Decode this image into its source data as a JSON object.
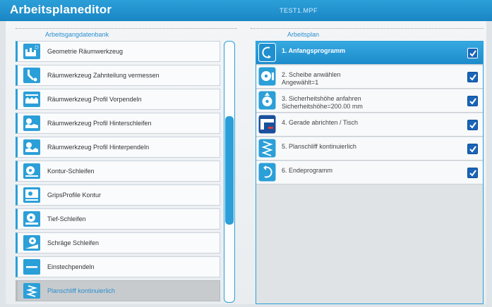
{
  "window": {
    "title": "Arbeitsplaneditor",
    "file_name": "TEST1.MPF"
  },
  "operations_db": {
    "heading": "Arbeitsgangdatenbank",
    "items": [
      {
        "label": "Geometrie Räumwerkzeug",
        "icon": "broach-geometry-icon"
      },
      {
        "label": "Räumwerkzeug Zahnteilung vermessen",
        "icon": "measure-probe-icon"
      },
      {
        "label": "Räumwerkzeug Profil Vorpendeln",
        "icon": "broach-profile-icon"
      },
      {
        "label": "Räumwerkzeug Profil Hinterschleifen",
        "icon": "broach-relief-icon"
      },
      {
        "label": "Räumwerkzeug Profil Hinterpendeln",
        "icon": "broach-backswing-icon"
      },
      {
        "label": "Kontur-Schleifen",
        "icon": "contour-grinding-icon"
      },
      {
        "label": "GripsProfile Kontur",
        "icon": "gripsprofile-icon"
      },
      {
        "label": "Tief-Schleifen",
        "icon": "deep-grinding-icon"
      },
      {
        "label": "Schräge Schleifen",
        "icon": "angled-grinding-icon"
      },
      {
        "label": "Einstechpendeln",
        "icon": "plunge-oscillation-icon"
      },
      {
        "label": "Planschliff kontinuierlich",
        "icon": "surface-grinding-icon",
        "selected": true
      }
    ]
  },
  "work_plan": {
    "heading": "Arbeitsplan",
    "accent_color": "#2b9fd8",
    "steps": [
      {
        "label": "1. Anfangsprogramm",
        "sub": "",
        "icon": "start-program-icon",
        "checked": true,
        "active": true
      },
      {
        "label": "2. Scheibe anwählen",
        "sub": "Angewählt=1",
        "icon": "select-wheel-icon",
        "checked": true
      },
      {
        "label": "3. Sicherheitshöhe anfahren",
        "sub": "Sicherheitshöhe=200.00 mm",
        "icon": "safety-height-icon",
        "checked": true
      },
      {
        "label": "4. Gerade abrichten / Tisch",
        "sub": "",
        "icon": "dress-straight-icon",
        "checked": true
      },
      {
        "label": "5. Planschliff kontinuierlich",
        "sub": "",
        "icon": "surface-grinding-icon",
        "checked": true
      },
      {
        "label": "6. Endeprogramm",
        "sub": "",
        "icon": "end-program-icon",
        "checked": true
      }
    ]
  }
}
